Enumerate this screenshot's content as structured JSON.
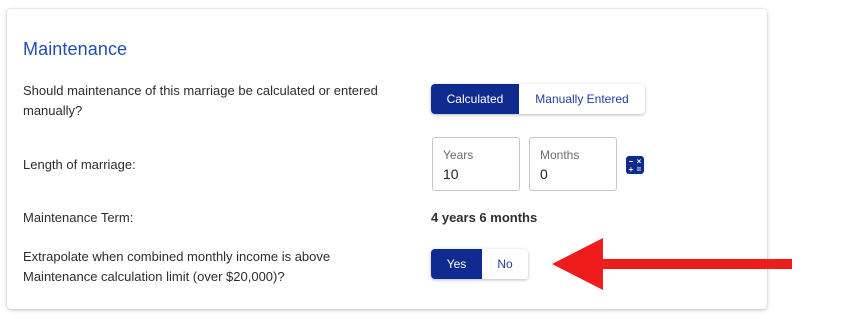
{
  "section": {
    "title": "Maintenance"
  },
  "calculation": {
    "question": "Should maintenance of this marriage be calculated or entered manually?",
    "options": [
      "Calculated",
      "Manually Entered"
    ],
    "selected": "Calculated"
  },
  "length": {
    "label": "Length of marriage:",
    "years_label": "Years",
    "years_value": "10",
    "months_label": "Months",
    "months_value": "0",
    "calculator_icon": "calculator-icon"
  },
  "term": {
    "label": "Maintenance Term:",
    "value": "4 years 6 months"
  },
  "extrapolate": {
    "question": "Extrapolate when combined monthly income is above Maintenance calculation limit (over $20,000)?",
    "options": [
      "Yes",
      "No"
    ],
    "selected": "Yes"
  },
  "annotation": {
    "arrow_icon": "red-arrow-left-icon",
    "arrow_color": "#ee1c1c"
  },
  "colors": {
    "accent": "#0f2b8f",
    "title": "#1f4fb3"
  }
}
